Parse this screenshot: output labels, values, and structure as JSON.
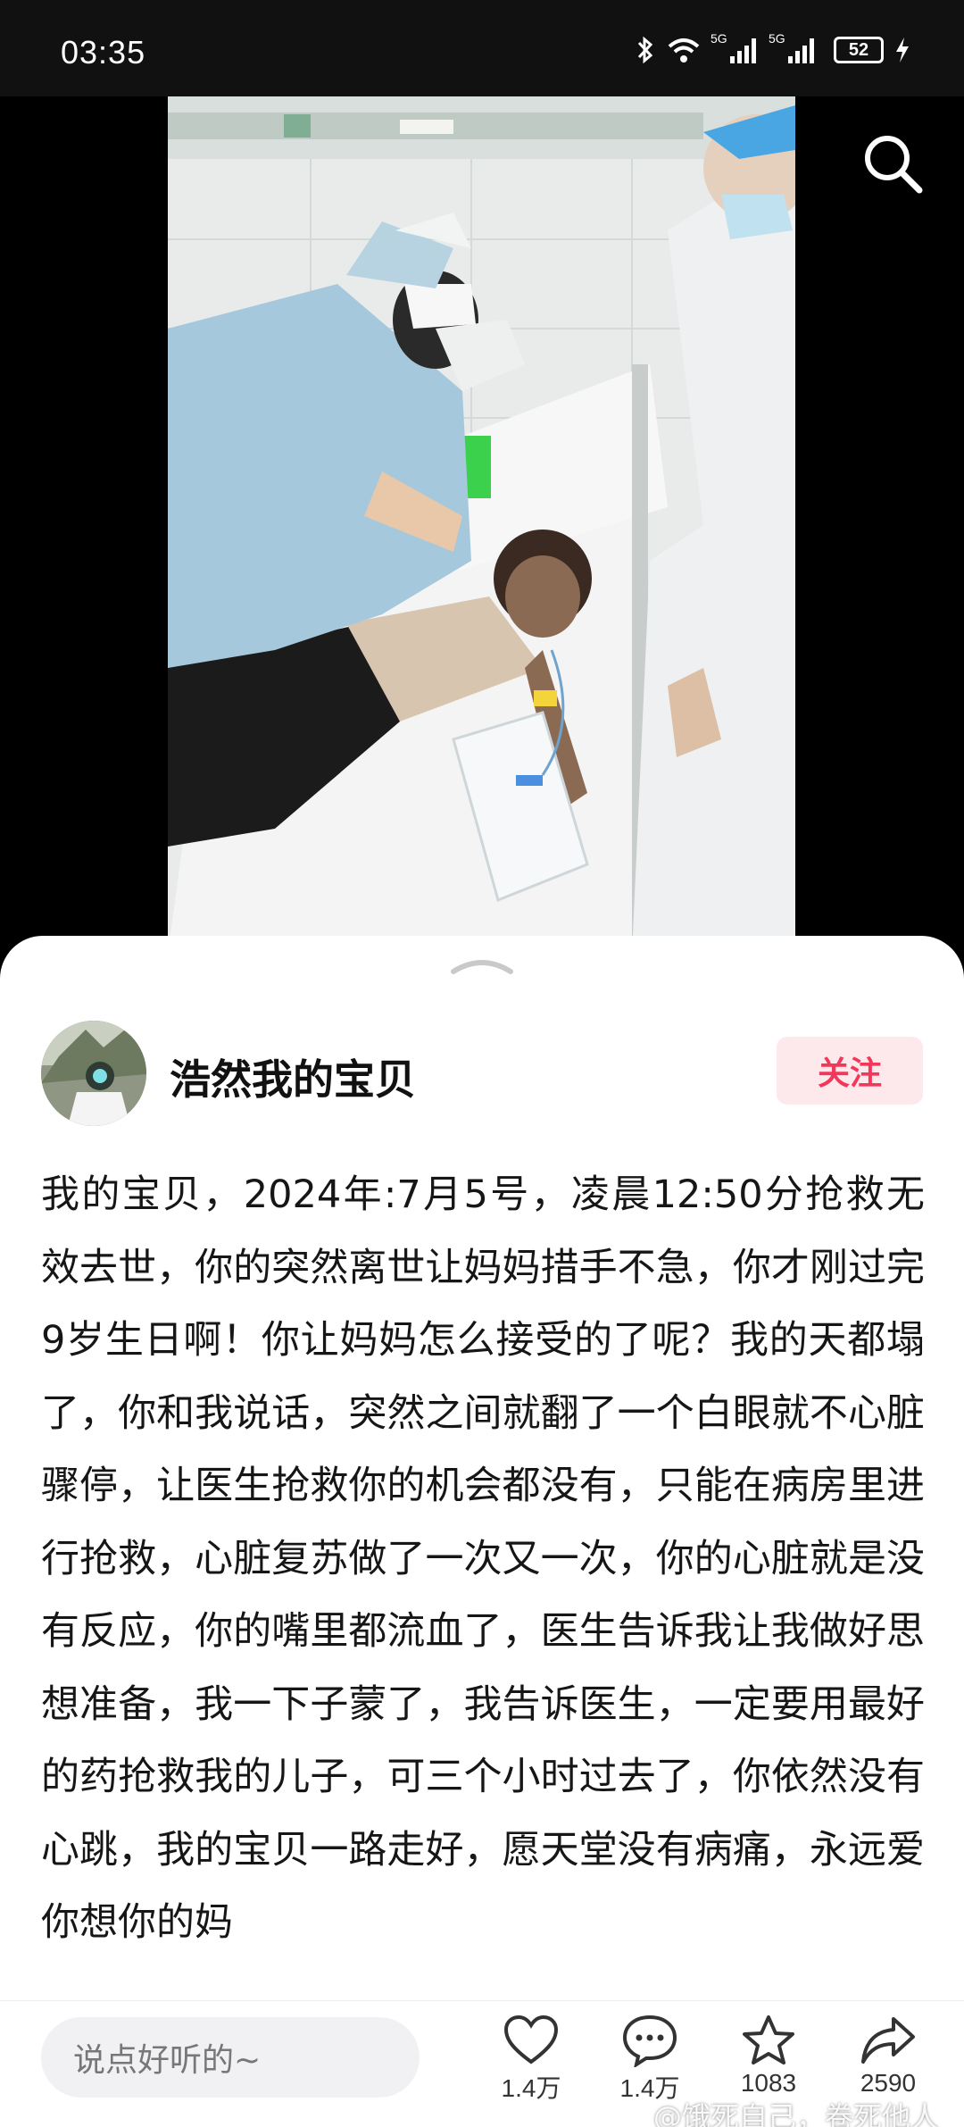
{
  "status_bar": {
    "time": "03:35",
    "signal_1_label": "5G",
    "signal_2_label": "5G",
    "battery": "52"
  },
  "video": {
    "search_icon": "search-icon"
  },
  "post": {
    "author_name": "浩然我的宝贝",
    "follow_label": "关注",
    "text": "我的宝贝，2024年:7月5号，凌晨12:50分抢救无效去世，你的突然离世让妈妈措手不急，你才刚过完9岁生日啊！你让妈妈怎么接受的了呢？我的天都塌了，你和我说话，突然之间就翻了一个白眼就不心脏骤停，让医生抢救你的机会都没有，只能在病房里进行抢救，心脏复苏做了一次又一次，你的心脏就是没有反应，你的嘴里都流血了，医生告诉我让我做好思想准备，我一下子蒙了，我告诉医生，一定要用最好的药抢救我的儿子，可三个小时过去了，你依然没有心跳，我的宝贝一路走好，愿天堂没有病痛，永远爱你想你的妈"
  },
  "comment_bar": {
    "placeholder": "说点好听的~",
    "like_count": "1.4万",
    "comment_count": "1.4万",
    "star_count": "1083",
    "share_count": "2590"
  },
  "watermark": "@饿死自己，卷死他人"
}
